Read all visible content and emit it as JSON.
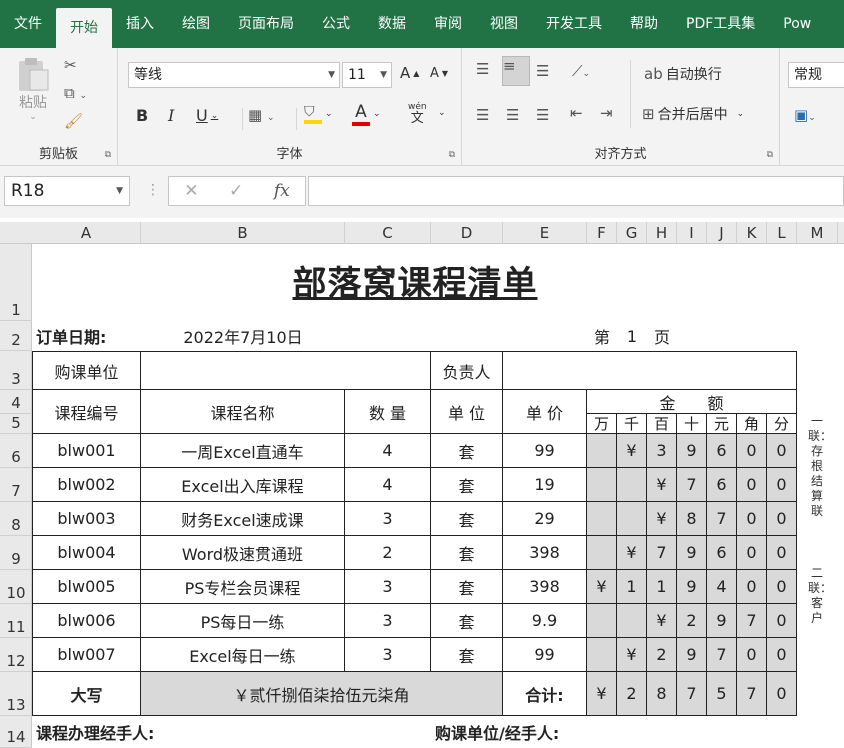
{
  "tabs": [
    "文件",
    "开始",
    "插入",
    "绘图",
    "页面布局",
    "公式",
    "数据",
    "审阅",
    "视图",
    "开发工具",
    "帮助",
    "PDF工具集",
    "Pow"
  ],
  "ribbon": {
    "clipboard": {
      "label": "剪贴板",
      "paste": "粘贴"
    },
    "font": {
      "label": "字体",
      "name": "等线",
      "size": "11",
      "bold": "B",
      "italic": "I",
      "underline": "U",
      "font_color_letter": "A",
      "phonetic_top": "wén",
      "phonetic_bottom": "文",
      "grow": "A",
      "shrink": "A"
    },
    "align": {
      "label": "对齐方式",
      "wrap": "自动换行",
      "merge": "合并后居中"
    },
    "number": {
      "format": "常规"
    }
  },
  "formula_bar": {
    "name_box": "R18",
    "fx": "fx",
    "cancel": "✕",
    "enter": "✓",
    "value": ""
  },
  "columns": [
    "A",
    "B",
    "C",
    "D",
    "E",
    "F",
    "G",
    "H",
    "I",
    "J",
    "K",
    "L",
    "M"
  ],
  "rows": [
    "1",
    "2",
    "3",
    "4",
    "5",
    "6",
    "7",
    "8",
    "9",
    "10",
    "11",
    "12",
    "13",
    "14"
  ],
  "sheet": {
    "title": "部落窝课程清单",
    "order_date_label": "订单日期:",
    "order_date": "2022年7月10日",
    "page_prefix": "第",
    "page_num": "1",
    "page_suffix": "页",
    "buyer_label": "购课单位",
    "buyer_value": "",
    "owner_label": "负责人",
    "owner_value": "",
    "headers": {
      "code": "课程编号",
      "name": "课程名称",
      "qty": "数 量",
      "unit": "单 位",
      "price": "单 价",
      "amount": "金　　额"
    },
    "digits": [
      "万",
      "千",
      "百",
      "十",
      "元",
      "角",
      "分"
    ],
    "items": [
      {
        "code": "blw001",
        "name": "一周Excel直通车",
        "qty": "4",
        "unit": "套",
        "price": "99",
        "d": [
          "",
          "¥",
          "3",
          "9",
          "6",
          "0",
          "0"
        ]
      },
      {
        "code": "blw002",
        "name": "Excel出入库课程",
        "qty": "4",
        "unit": "套",
        "price": "19",
        "d": [
          "",
          "",
          "¥",
          "7",
          "6",
          "0",
          "0"
        ]
      },
      {
        "code": "blw003",
        "name": "财务Excel速成课",
        "qty": "3",
        "unit": "套",
        "price": "29",
        "d": [
          "",
          "",
          "¥",
          "8",
          "7",
          "0",
          "0"
        ]
      },
      {
        "code": "blw004",
        "name": "Word极速贯通班",
        "qty": "2",
        "unit": "套",
        "price": "398",
        "d": [
          "",
          "¥",
          "7",
          "9",
          "6",
          "0",
          "0"
        ]
      },
      {
        "code": "blw005",
        "name": "PS专栏会员课程",
        "qty": "3",
        "unit": "套",
        "price": "398",
        "d": [
          "¥",
          "1",
          "1",
          "9",
          "4",
          "0",
          "0"
        ]
      },
      {
        "code": "blw006",
        "name": "PS每日一练",
        "qty": "3",
        "unit": "套",
        "price": "9.9",
        "d": [
          "",
          "",
          "¥",
          "2",
          "9",
          "7",
          "0"
        ]
      },
      {
        "code": "blw007",
        "name": "Excel每日一练",
        "qty": "3",
        "unit": "套",
        "price": "99",
        "d": [
          "",
          "¥",
          "2",
          "9",
          "7",
          "0",
          "0"
        ]
      }
    ],
    "capital_label": "大写",
    "capital_value": "￥贰仟捌佰柒拾伍元柒角",
    "total_label": "合计:",
    "total_digits": [
      "¥",
      "2",
      "8",
      "7",
      "5",
      "7",
      "0"
    ],
    "handler_label": "课程办理经手人:",
    "buyer_handler_label": "购课单位/经手人:",
    "side_note_1": "一联：存根结算联",
    "side_note_2": "二联：客户"
  }
}
